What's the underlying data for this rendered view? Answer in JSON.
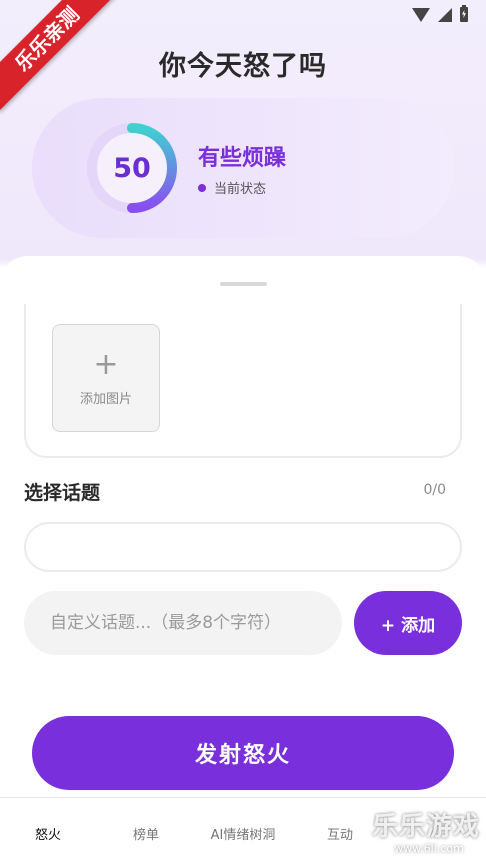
{
  "status_bar": {
    "icons": [
      "wifi-icon",
      "signal-icon",
      "battery-charging-icon"
    ]
  },
  "watermark_ribbon": "乐乐亲测",
  "page": {
    "title": "你今天怒了吗"
  },
  "mood": {
    "score": "50",
    "score_fraction": 0.5,
    "label": "有些烦躁",
    "sublabel": "当前状态",
    "accent": "#7b2fdb",
    "gauge_colors": [
      "#3fd1d0",
      "#8a4df0"
    ]
  },
  "upload": {
    "plus": "+",
    "add_image_label": "添加图片"
  },
  "topic": {
    "title": "选择话题",
    "count": "0/0",
    "custom_placeholder": "自定义话题...（最多8个字符）",
    "add_label": "+ 添加"
  },
  "submit": {
    "label": "发射怒火",
    "color": "#7a2fdc"
  },
  "tabs": [
    {
      "label": "怒火",
      "active": true
    },
    {
      "label": "榜单",
      "active": false
    },
    {
      "label": "AI情绪树洞",
      "active": false
    },
    {
      "label": "互动",
      "active": false
    }
  ],
  "watermark": {
    "main": "乐乐游戏",
    "sub": "www.6ll.com"
  }
}
